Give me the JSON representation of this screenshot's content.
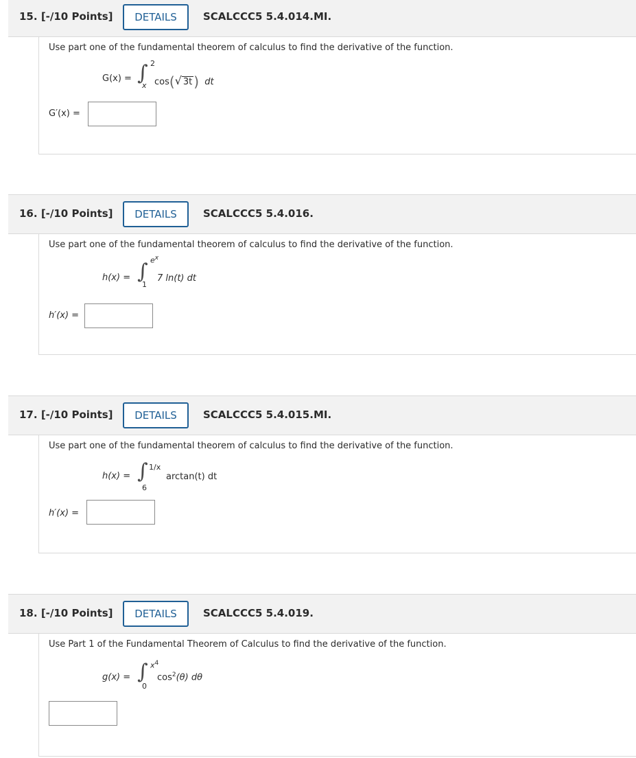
{
  "questions": [
    {
      "number": "15.",
      "points": "[-/10 Points]",
      "details_label": "DETAILS",
      "code": "SCALCCC5 5.4.014.MI.",
      "prompt": "Use part one of the fundamental theorem of calculus to find the derivative of the function.",
      "func_lhs": "G(x) =",
      "upper": "2",
      "lower": "x",
      "integrand_prefix": "cos",
      "integrand_radicand": "3t",
      "differential": "dt",
      "answer_label": "G′(x) ="
    },
    {
      "number": "16.",
      "points": "[-/10 Points]",
      "details_label": "DETAILS",
      "code": "SCALCCC5 5.4.016.",
      "prompt": "Use part one of the fundamental theorem of calculus to find the derivative of the function.",
      "func_lhs": "h(x) =",
      "upper": "e",
      "upper_exp": "x",
      "lower": "1",
      "integrand": "7 ln(t) dt",
      "answer_label": "h′(x) ="
    },
    {
      "number": "17.",
      "points": "[-/10 Points]",
      "details_label": "DETAILS",
      "code": "SCALCCC5 5.4.015.MI.",
      "prompt": "Use part one of the fundamental theorem of calculus to find the derivative of the function.",
      "func_lhs": "h(x) =",
      "upper": "1/x",
      "lower": "6",
      "integrand": "arctan(t) dt",
      "answer_label": "h′(x) ="
    },
    {
      "number": "18.",
      "points": "[-/10 Points]",
      "details_label": "DETAILS",
      "code": "SCALCCC5 5.4.019.",
      "prompt": "Use Part 1 of the Fundamental Theorem of Calculus to find the derivative of the function.",
      "func_lhs": "g(x) =",
      "upper": "x",
      "upper_exp": "4",
      "lower": "0",
      "integrand": "cos",
      "integrand_exp": "2",
      "integrand_rest": "(θ) dθ"
    }
  ],
  "colors": {
    "accent": "#1f5f95",
    "header_bg": "#f2f2f2",
    "border": "#d9d9d9"
  }
}
